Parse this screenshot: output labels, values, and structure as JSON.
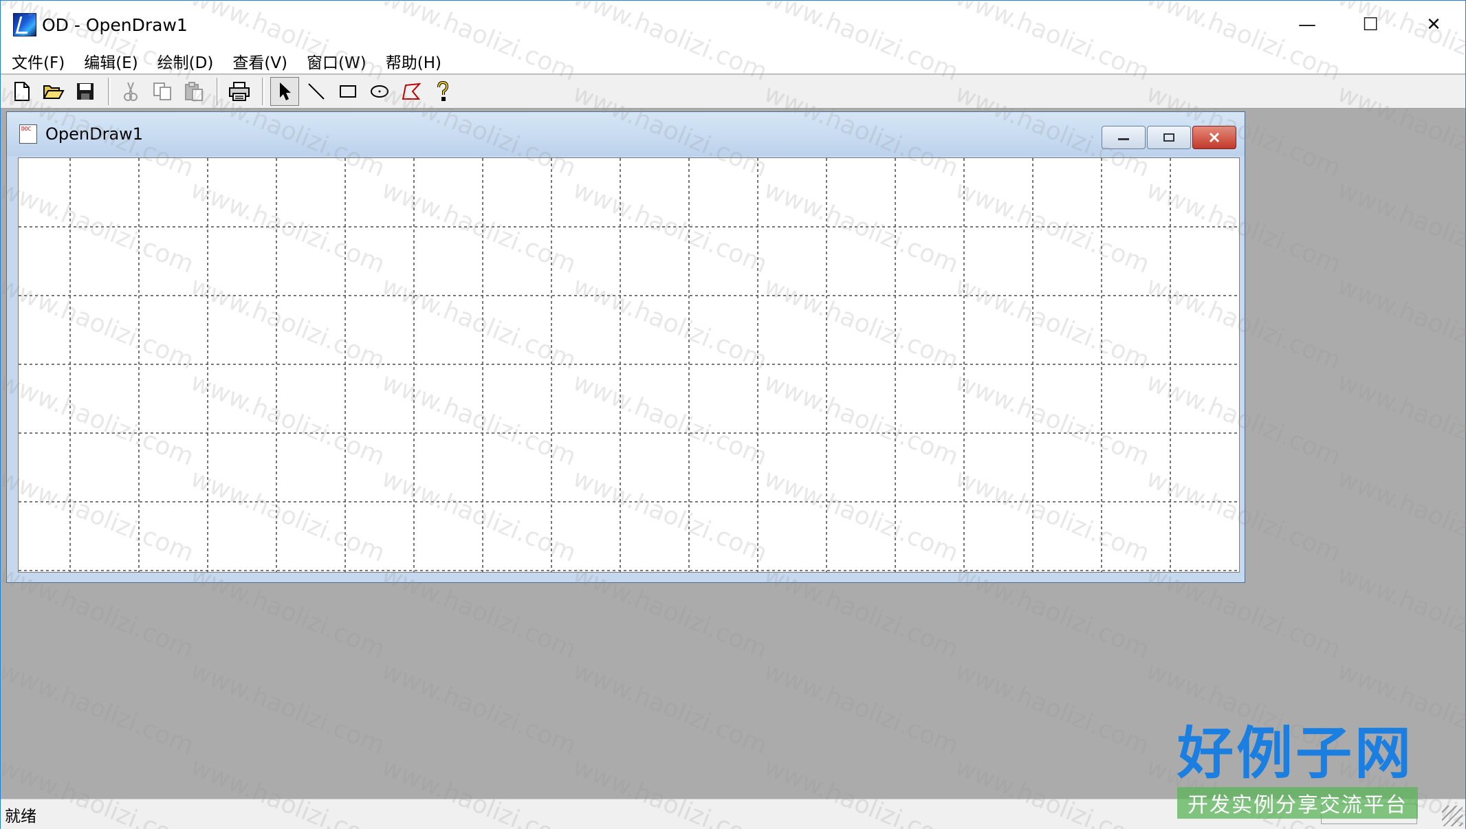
{
  "window": {
    "title": "OD - OpenDraw1"
  },
  "caption": {
    "minimize": "—",
    "maximize": "☐",
    "close": "✕"
  },
  "menu": [
    {
      "label": "文件(F)"
    },
    {
      "label": "编辑(E)"
    },
    {
      "label": "绘制(D)"
    },
    {
      "label": "查看(V)"
    },
    {
      "label": "窗口(W)"
    },
    {
      "label": "帮助(H)"
    }
  ],
  "toolbar": {
    "groups": [
      [
        "new-icon",
        "open-icon",
        "save-icon"
      ],
      [
        "cut-icon",
        "copy-icon",
        "paste-icon"
      ],
      [
        "print-icon"
      ],
      [
        "select-arrow-icon",
        "line-icon",
        "rectangle-icon",
        "ellipse-icon",
        "polygon-icon",
        "help-icon"
      ]
    ],
    "pressed": "select-arrow-icon"
  },
  "child": {
    "title": "OpenDraw1",
    "icon": "document-icon",
    "grid_columns": 18,
    "grid_rows": 6
  },
  "status": {
    "text": "就绪"
  },
  "watermark": {
    "text": "www.haolizi.com",
    "logo": "好例子网",
    "tagline": "开发实例分享交流平台"
  }
}
